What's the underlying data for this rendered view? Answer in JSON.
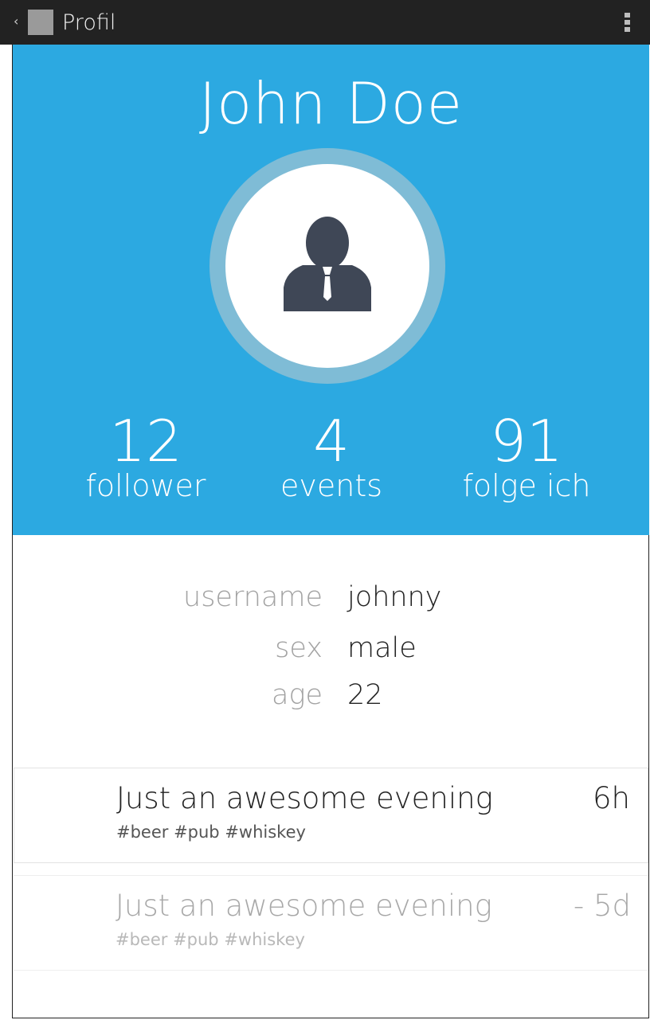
{
  "actionbar": {
    "title": "Profil",
    "back_icon": "chevron-left-icon",
    "app_icon": "app-icon",
    "overflow_icon": "overflow-menu-icon"
  },
  "profile": {
    "name": "John Doe",
    "avatar_icon": "person-silhouette-icon",
    "stats": [
      {
        "value": "12",
        "label": "follower"
      },
      {
        "value": "4",
        "label": "events"
      },
      {
        "value": "91",
        "label": "folge ich"
      }
    ]
  },
  "info": [
    {
      "label": "username",
      "value": "johnny"
    },
    {
      "label": "sex",
      "value": "male"
    },
    {
      "label": "age",
      "value": "22"
    }
  ],
  "events": [
    {
      "title": "Just an awesome evening",
      "tags": "#beer #pub #whiskey",
      "time": "6h"
    },
    {
      "title": "Just an awesome evening",
      "tags": "#beer #pub #whiskey",
      "time": "- 5d"
    }
  ],
  "colors": {
    "header_bg": "#2ca9e1",
    "avatar_ring": "#7fbcd6",
    "actionbar_bg": "#222222",
    "avatar_icon": "#3f4756"
  }
}
